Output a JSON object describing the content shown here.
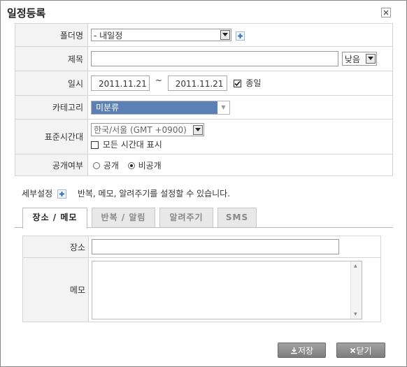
{
  "dialog": {
    "title": "일정등록"
  },
  "form": {
    "folder": {
      "label": "폴더명",
      "value": "- 내일정"
    },
    "subject": {
      "label": "제목",
      "value": "",
      "importance": "낮음"
    },
    "datetime": {
      "label": "일시",
      "start": "2011.11.21",
      "separator": "~",
      "end": "2011.11.21",
      "allday_label": "종일",
      "allday_checked": true
    },
    "category": {
      "label": "카테고리",
      "value": "미분류",
      "color": "#5b80b5"
    },
    "timezone": {
      "label": "표준시간대",
      "value": "한국/서울 (GMT +0900)",
      "show_all_label": "모든 시간대 표시",
      "show_all_checked": false
    },
    "visibility": {
      "label": "공개여부",
      "public_label": "공개",
      "private_label": "비공개",
      "selected": "비공개"
    }
  },
  "details": {
    "label": "세부설정",
    "hint": "반복, 메모, 알려주기를 설정할 수 있습니다."
  },
  "tabs": [
    {
      "label": "장소 / 메모",
      "active": true
    },
    {
      "label": "반복 / 알림",
      "active": false
    },
    {
      "label": "알려주기",
      "active": false
    },
    {
      "label": "SMS",
      "active": false
    }
  ],
  "place_memo": {
    "place_label": "장소",
    "place_value": "",
    "memo_label": "메모",
    "memo_value": ""
  },
  "buttons": {
    "save": "저장",
    "close": "닫기"
  }
}
